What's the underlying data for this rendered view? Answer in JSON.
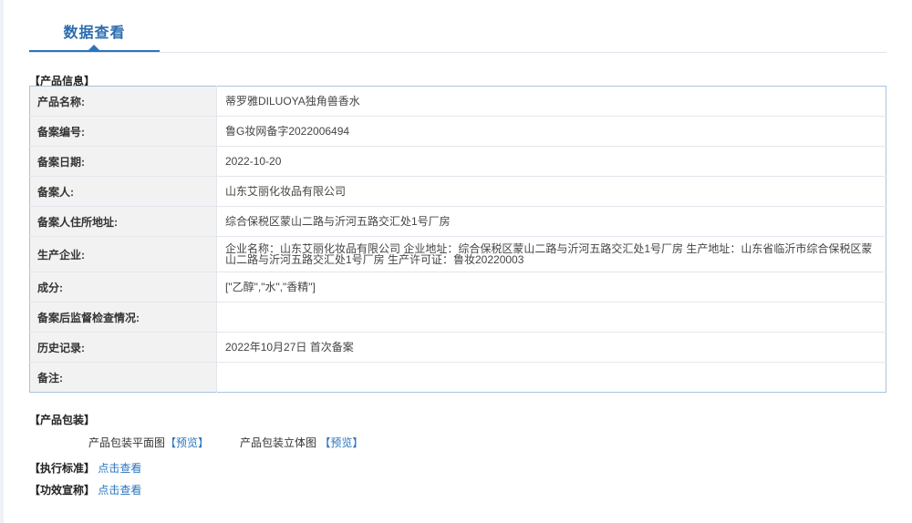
{
  "tab": {
    "label": "数据查看"
  },
  "product_info": {
    "title": "【产品信息】",
    "rows": [
      {
        "label": "产品名称:",
        "value": "蒂罗雅DILUOYA独角兽香水"
      },
      {
        "label": "备案编号:",
        "value": "鲁G妆网备字2022006494"
      },
      {
        "label": "备案日期:",
        "value": "2022-10-20"
      },
      {
        "label": "备案人:",
        "value": "山东艾丽化妆品有限公司"
      },
      {
        "label": "备案人住所地址:",
        "value": "综合保税区蒙山二路与沂河五路交汇处1号厂房"
      },
      {
        "label": "生产企业:",
        "value": "企业名称：山东艾丽化妆品有限公司 企业地址：综合保税区蒙山二路与沂河五路交汇处1号厂房 生产地址：山东省临沂市综合保税区蒙山二路与沂河五路交汇处1号厂房 生产许可证：鲁妆20220003"
      },
      {
        "label": "成分:",
        "value": "[\"乙醇\",\"水\",\"香精\"]"
      },
      {
        "label": "备案后监督检查情况:",
        "value": ""
      },
      {
        "label": "历史记录:",
        "value": "2022年10月27日 首次备案"
      },
      {
        "label": "备注:",
        "value": ""
      }
    ]
  },
  "packaging": {
    "title": "【产品包装】",
    "flat_label": "产品包装平面图",
    "flat_link": "【预览】",
    "stereo_label": "产品包装立体图",
    "stereo_link": "【预览】"
  },
  "standard": {
    "title": "【执行标准】",
    "link": "点击查看"
  },
  "efficacy": {
    "title": "【功效宣称】",
    "link": "点击查看"
  }
}
